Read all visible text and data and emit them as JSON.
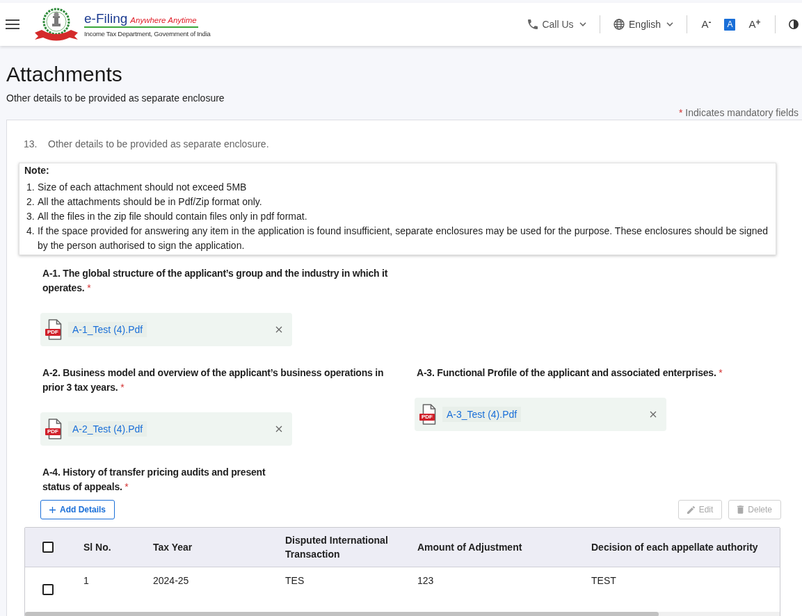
{
  "header": {
    "brand": "e-Filing",
    "tagline": "Anywhere Anytime",
    "department": "Income Tax Department, Government of India",
    "call_us": "Call Us",
    "language": "English",
    "font_size_controls": [
      {
        "label": "A$^{-}$",
        "selected": false
      },
      {
        "label": "A",
        "selected": true
      },
      {
        "label": "A$^{+}$",
        "selected": false
      }
    ]
  },
  "page": {
    "title": "Attachments",
    "subtitle": "Other details to be provided as separate enclosure",
    "mandatory_note": {
      "mark": "*",
      "text": "Indicates mandatory fields"
    }
  },
  "form": {
    "item": {
      "number": "13.",
      "text": "Other details to be provided as separate enclosure."
    },
    "note": {
      "title": "Note:",
      "items": [
        {
          "number": "1.",
          "text": "Size of each attachment should not exceed 5MB"
        },
        {
          "number": "2.",
          "text": "All the attachments should be in Pdf/Zip format only."
        },
        {
          "number": "3.",
          "text": "All the files in the zip file should contain files only in pdf format."
        },
        {
          "number": "4.",
          "text": "If the space provided for answering any item in the application is found insufficient, separate enclosures may be used for the purpose. These enclosures should be signed by the person authorised to sign the application."
        }
      ]
    },
    "question_rows": [
      [
        {
          "kind": "file",
          "label": "A-1. The global structure of the applicant’s group and the industry in which it operates.",
          "required_mark": "*",
          "attachments": [
            {
              "badge": "PDF",
              "file_name": "A-1_Test (4).Pdf"
            }
          ]
        }
      ],
      [
        {
          "kind": "file",
          "label": "A-2. Business model and overview of the applicant’s business operations in prior 3 tax years.",
          "required_mark": "*",
          "attachments": [
            {
              "badge": "PDF",
              "file_name": "A-2_Test (4).Pdf"
            }
          ]
        },
        {
          "kind": "file",
          "label": "A-3. Functional Profile of the applicant and associated enterprises.",
          "required_mark": "*",
          "attachments": [
            {
              "badge": "PDF",
              "file_name": "A-3_Test (4).Pdf"
            }
          ]
        }
      ],
      [
        {
          "kind": "table",
          "label": "A-4. History of transfer pricing audits and present status of appeals.",
          "required_mark": "*",
          "actions": [
            {
              "kind": "add",
              "label": "Add Details",
              "disabled": false
            },
            {
              "kind": "edit",
              "label": "Edit",
              "disabled": true
            },
            {
              "kind": "delete",
              "label": "Delete",
              "disabled": true
            }
          ],
          "table": {
            "header_checked": false,
            "columns": [
              "Sl No.",
              "Tax Year",
              "Disputed International Transaction",
              "Amount of Adjustment",
              "Decision of each appellate authority"
            ],
            "rows": [
              {
                "checked": false,
                "cells": [
                  "1",
                  "2024-25",
                  "TES",
                  "123",
                  "TEST"
                ]
              }
            ]
          }
        }
      ]
    ]
  }
}
